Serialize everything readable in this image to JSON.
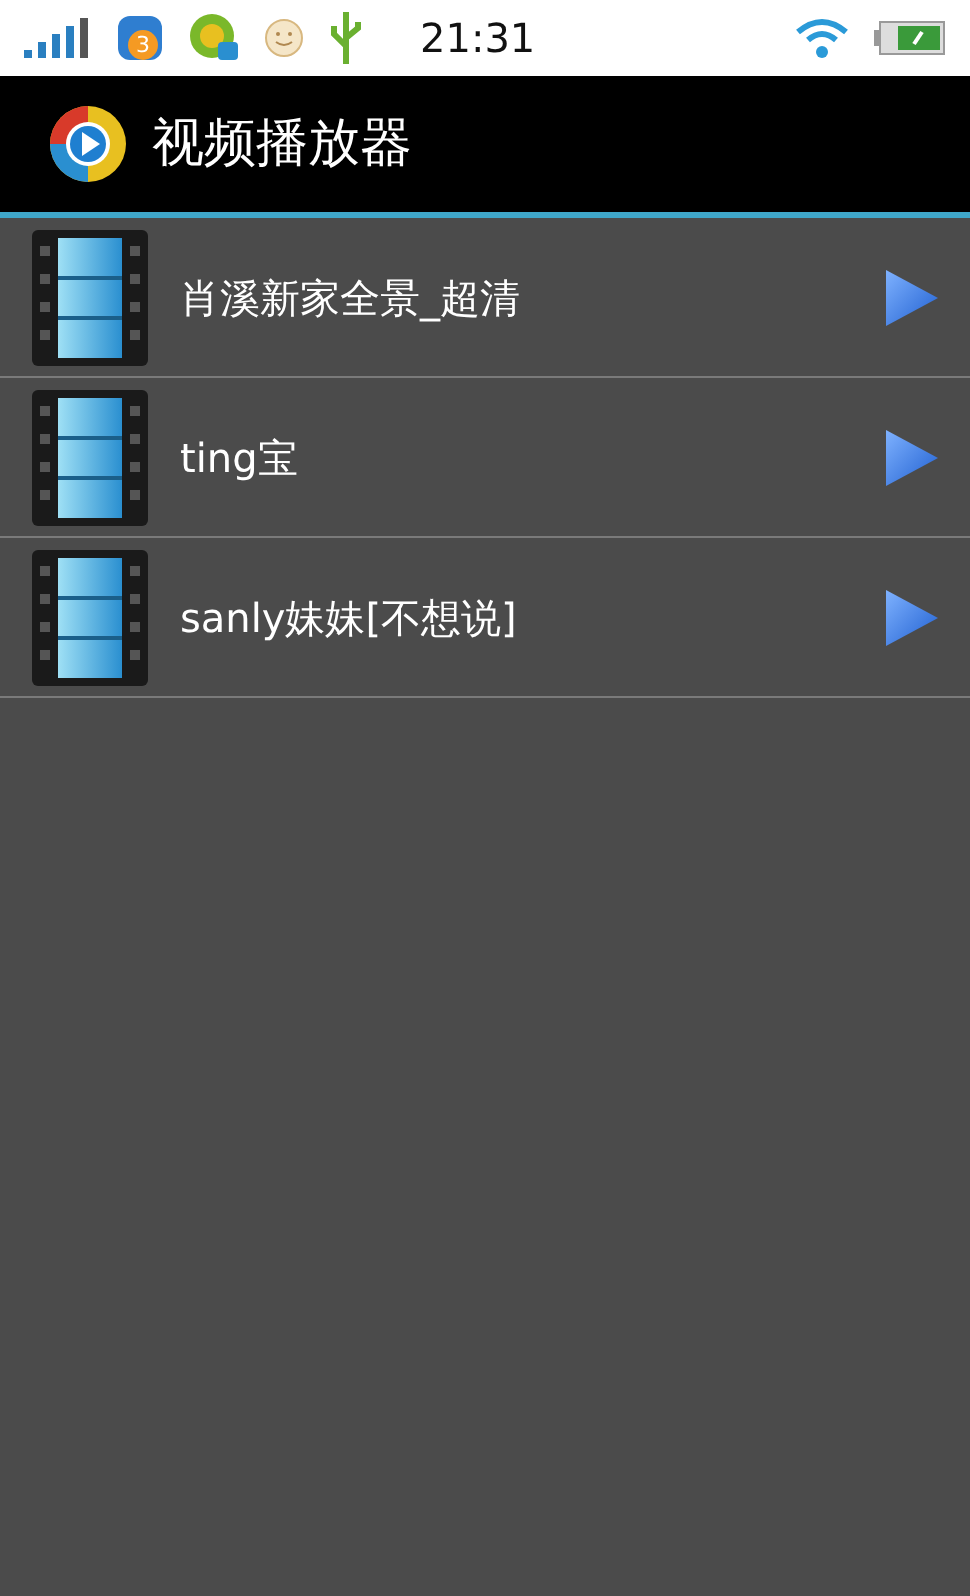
{
  "status_bar": {
    "notification_count": "3",
    "time": "21:31"
  },
  "app_bar": {
    "title": "视频播放器"
  },
  "videos": [
    {
      "title": "肖溪新家全景_超清"
    },
    {
      "title": "ting宝"
    },
    {
      "title": "sanly妹妹[不想说]"
    }
  ]
}
